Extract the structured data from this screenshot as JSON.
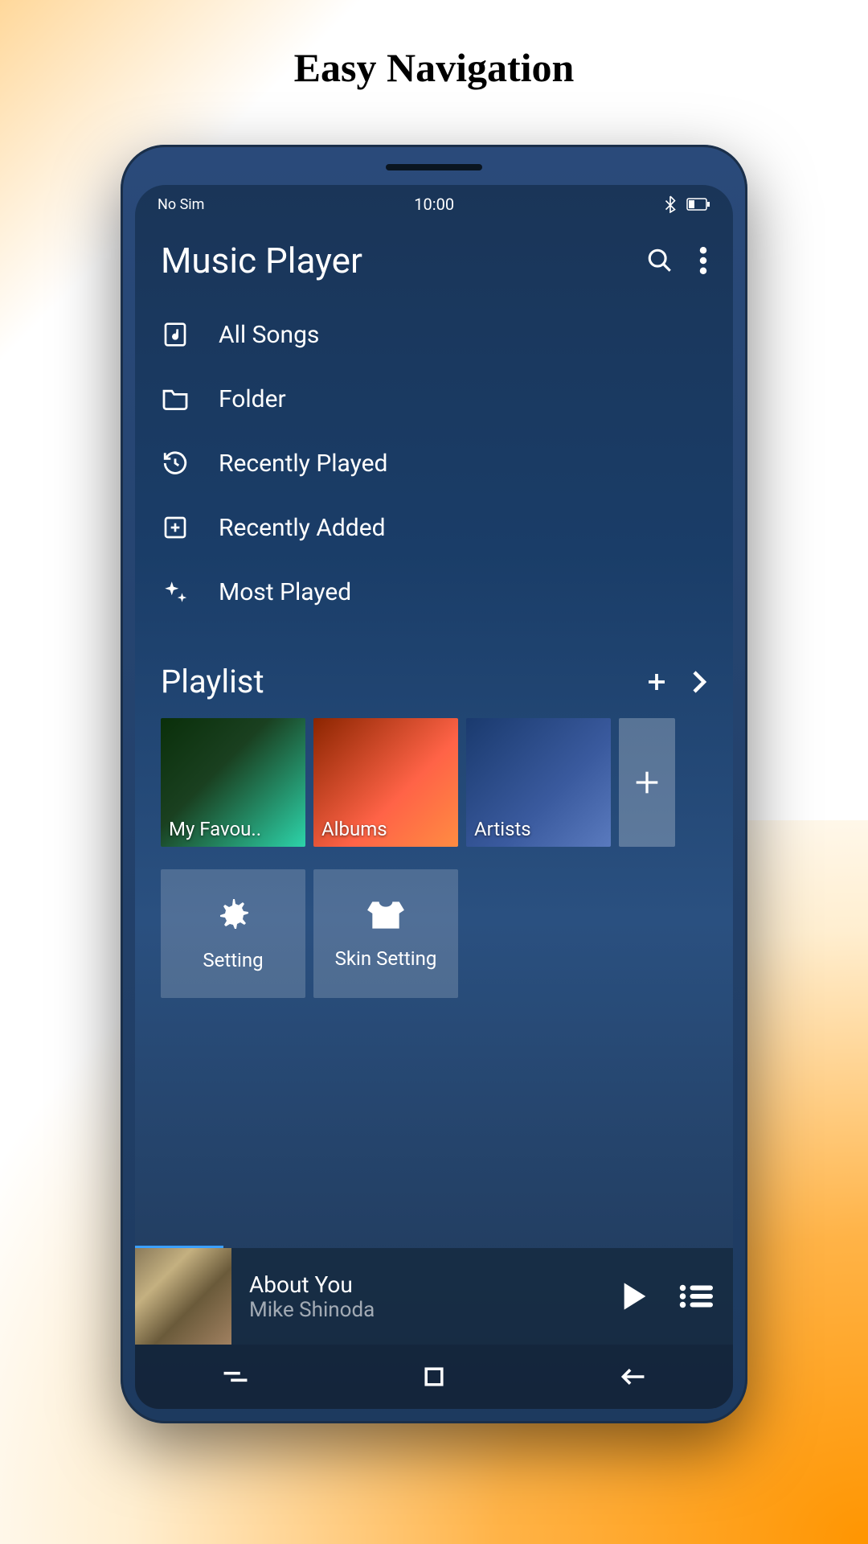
{
  "promo": {
    "title": "Easy Navigation"
  },
  "status": {
    "sim": "No Sim",
    "time": "10:00"
  },
  "header": {
    "title": "Music Player"
  },
  "nav": {
    "items": [
      {
        "label": "All Songs"
      },
      {
        "label": "Folder"
      },
      {
        "label": "Recently Played"
      },
      {
        "label": "Recently Added"
      },
      {
        "label": "Most Played"
      }
    ]
  },
  "playlist": {
    "title": "Playlist",
    "items": [
      {
        "label": "My Favou.."
      },
      {
        "label": "Albums"
      },
      {
        "label": "Artists"
      }
    ]
  },
  "settings": {
    "items": [
      {
        "label": "Setting"
      },
      {
        "label": "Skin Setting"
      }
    ]
  },
  "now_playing": {
    "title": "About You",
    "artist": "Mike Shinoda"
  }
}
